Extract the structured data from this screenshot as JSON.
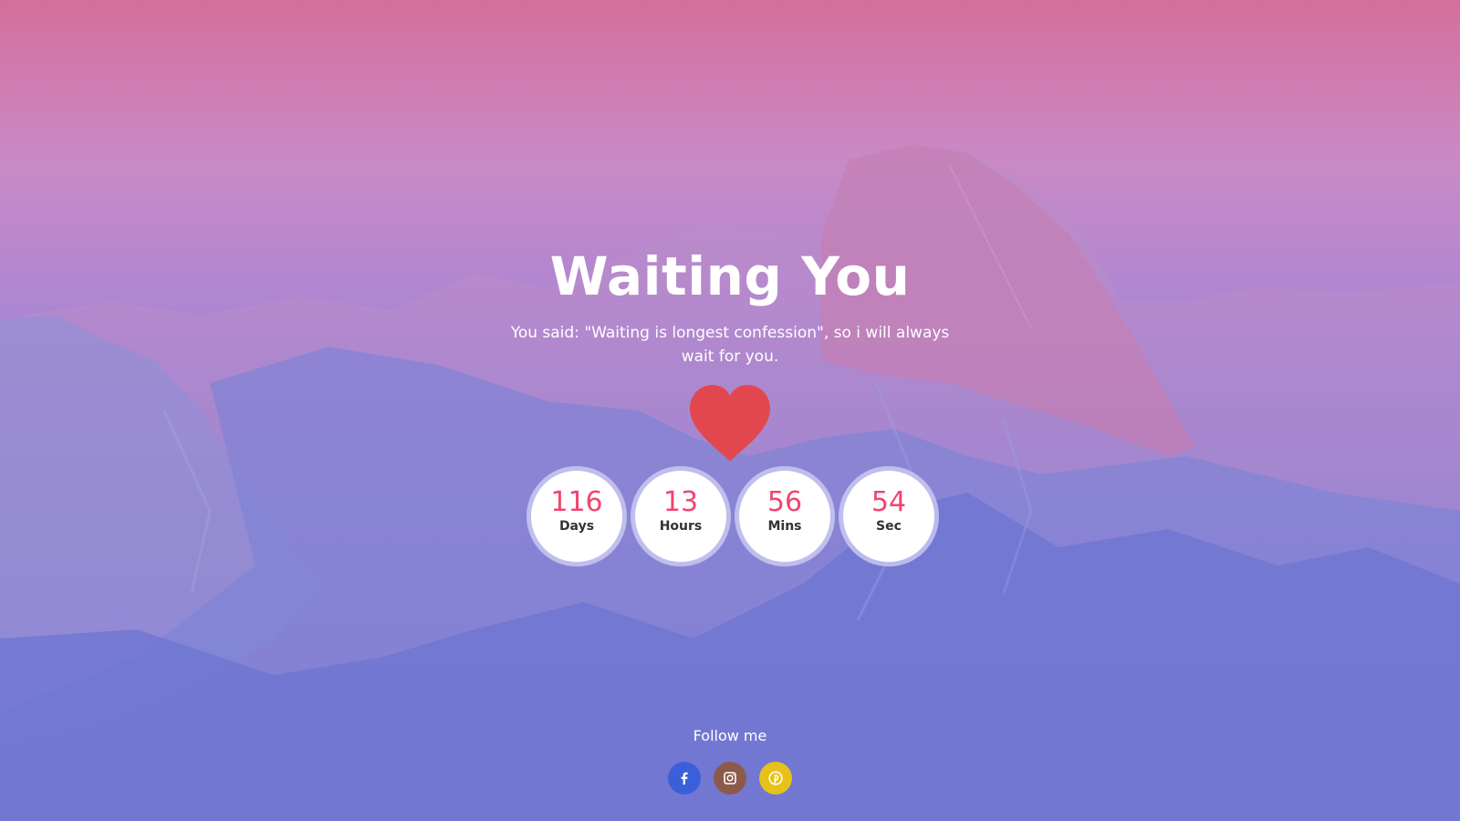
{
  "hero": {
    "title": "Waiting You",
    "subtitle": "You said: \"Waiting is longest confession\", so i will always wait for you.",
    "icon": "heart-icon",
    "icon_color": "#e2474f"
  },
  "countdown": [
    {
      "value": "116",
      "label": "Days"
    },
    {
      "value": "13",
      "label": "Hours"
    },
    {
      "value": "56",
      "label": "Mins"
    },
    {
      "value": "54",
      "label": "Sec"
    }
  ],
  "countdown_number_color": "#f2456f",
  "footer": {
    "follow_label": "Follow me",
    "social": [
      {
        "icon": "facebook-icon",
        "color": "#3b5fd9"
      },
      {
        "icon": "instagram-icon",
        "color": "#8b5a4a"
      },
      {
        "icon": "pinterest-icon",
        "color": "#e6c21a"
      }
    ]
  },
  "colors": {
    "background_top": "#d46f9c",
    "background_bottom": "#5f70d6"
  }
}
